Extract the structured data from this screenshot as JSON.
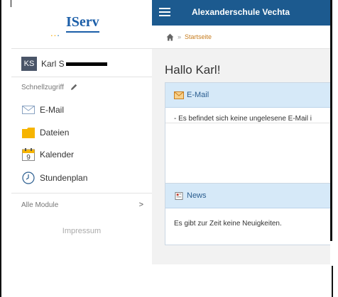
{
  "logo": {
    "dots": "...",
    "text": "IServ"
  },
  "user": {
    "initials": "KS",
    "name": "Karl S"
  },
  "sidebar": {
    "quick_access_label": "Schnellzugriff",
    "items": [
      {
        "label": "E-Mail",
        "icon": "envelope-icon"
      },
      {
        "label": "Dateien",
        "icon": "folder-icon"
      },
      {
        "label": "Kalender",
        "icon": "calendar-icon",
        "calendar_day": "9"
      },
      {
        "label": "Stundenplan",
        "icon": "clock-icon"
      }
    ],
    "all_modules_label": "Alle Module",
    "all_modules_chevron": ">",
    "impressum_label": "Impressum"
  },
  "header": {
    "title": "Alexanderschule Vechta"
  },
  "breadcrumb": {
    "separator": "»",
    "current": "Startseite"
  },
  "main": {
    "greeting": "Hallo Karl!",
    "email_panel": {
      "title": "E-Mail",
      "message": "- Es befindet sich keine ungelesene E-Mail i"
    },
    "news_panel": {
      "title": "News",
      "message": "Es gibt zur Zeit keine Neuigkeiten."
    }
  },
  "colors": {
    "topbar": "#1c5a8f",
    "panel_header": "#d6e9f8",
    "breadcrumb_link": "#c87d1e",
    "folder": "#f6b400"
  }
}
